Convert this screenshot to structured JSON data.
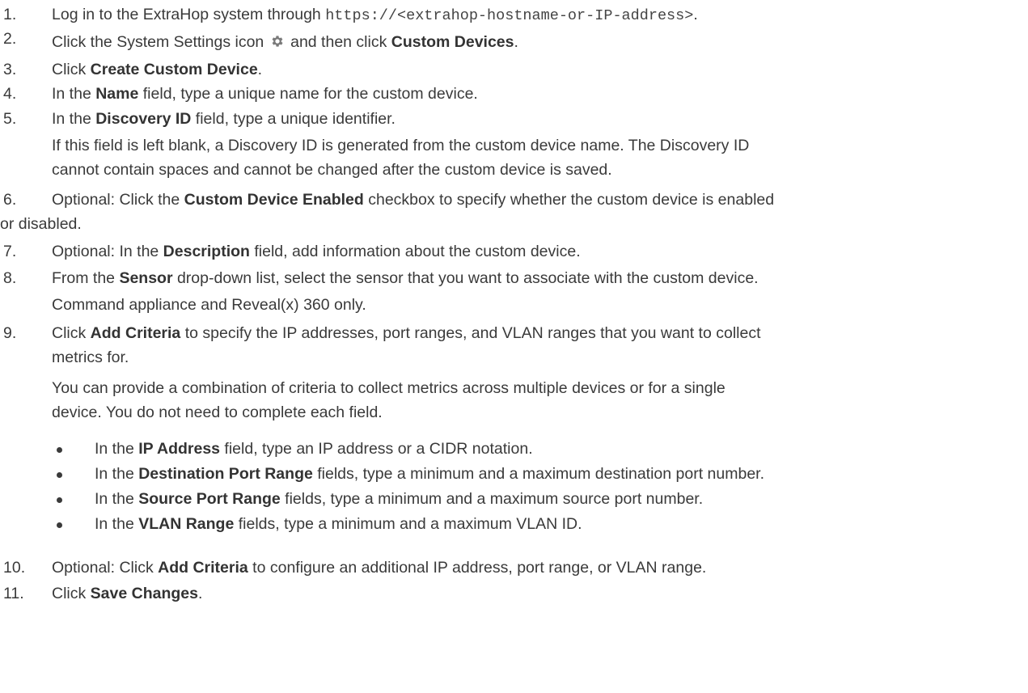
{
  "steps": [
    {
      "num": "1.",
      "pre": "Log in to the ExtraHop system through ",
      "code": "https://<extrahop-hostname-or-IP-address>",
      "post": "."
    },
    {
      "num": "2.",
      "pre": "Click the System Settings icon ",
      "icon": "gear-icon",
      "mid": " and then click ",
      "bold": "Custom Devices",
      "post": "."
    },
    {
      "num": "3.",
      "pre": "Click ",
      "bold": "Create Custom Device",
      "post": "."
    },
    {
      "num": "4.",
      "pre": "In the ",
      "bold": "Name",
      "post": " field, type a unique name for the custom device."
    },
    {
      "num": "5.",
      "pre": "In the ",
      "bold": "Discovery ID",
      "post": " field, type a unique identifier.",
      "note1": "If this field is left blank, a Discovery ID is generated from the custom device name. The Discovery ID",
      "note2": "cannot contain spaces and cannot be changed after the custom device is saved."
    },
    {
      "num": "6.",
      "pre": "Optional: Click the ",
      "bold": "Custom Device Enabled",
      "post": " checkbox to specify whether the custom device is enabled",
      "line2": "or disabled."
    },
    {
      "num": "7.",
      "pre": "Optional: In the ",
      "bold": "Description",
      "post": " field, add information about the custom device."
    },
    {
      "num": "8.",
      "pre": "From the ",
      "bold": "Sensor",
      "post": " drop-down list, select the sensor that you want to associate with the custom device.",
      "note1": "Command appliance and Reveal(x) 360 only."
    },
    {
      "num": "9.",
      "pre": "Click ",
      "bold": "Add Criteria",
      "post": " to specify the IP addresses, port ranges, and VLAN ranges that you want to collect",
      "line2": "metrics for.",
      "note1": "You can provide a combination of criteria to collect metrics across multiple devices or for a single",
      "note2": "device. You do not need to complete each field."
    },
    {
      "num": "10.",
      "pre": "Optional: Click ",
      "bold": "Add Criteria",
      "post": " to configure an additional IP address, port range, or VLAN range."
    },
    {
      "num": "11.",
      "pre": "Click ",
      "bold": "Save Changes",
      "post": "."
    }
  ],
  "bullets": [
    {
      "pre": "In the ",
      "bold": "IP Address",
      "post": " field, type an IP address or a CIDR notation."
    },
    {
      "pre": "In the ",
      "bold": "Destination Port Range",
      "post": " fields, type a minimum and a maximum destination port number."
    },
    {
      "pre": "In the ",
      "bold": "Source Port Range",
      "post": " fields, type a minimum and a maximum source port number."
    },
    {
      "pre": "In the ",
      "bold": "VLAN Range",
      "post": " fields, type a minimum and a maximum VLAN ID."
    }
  ],
  "colors": {
    "text": "#3a3a3a",
    "icon": "#7a7a7a"
  }
}
